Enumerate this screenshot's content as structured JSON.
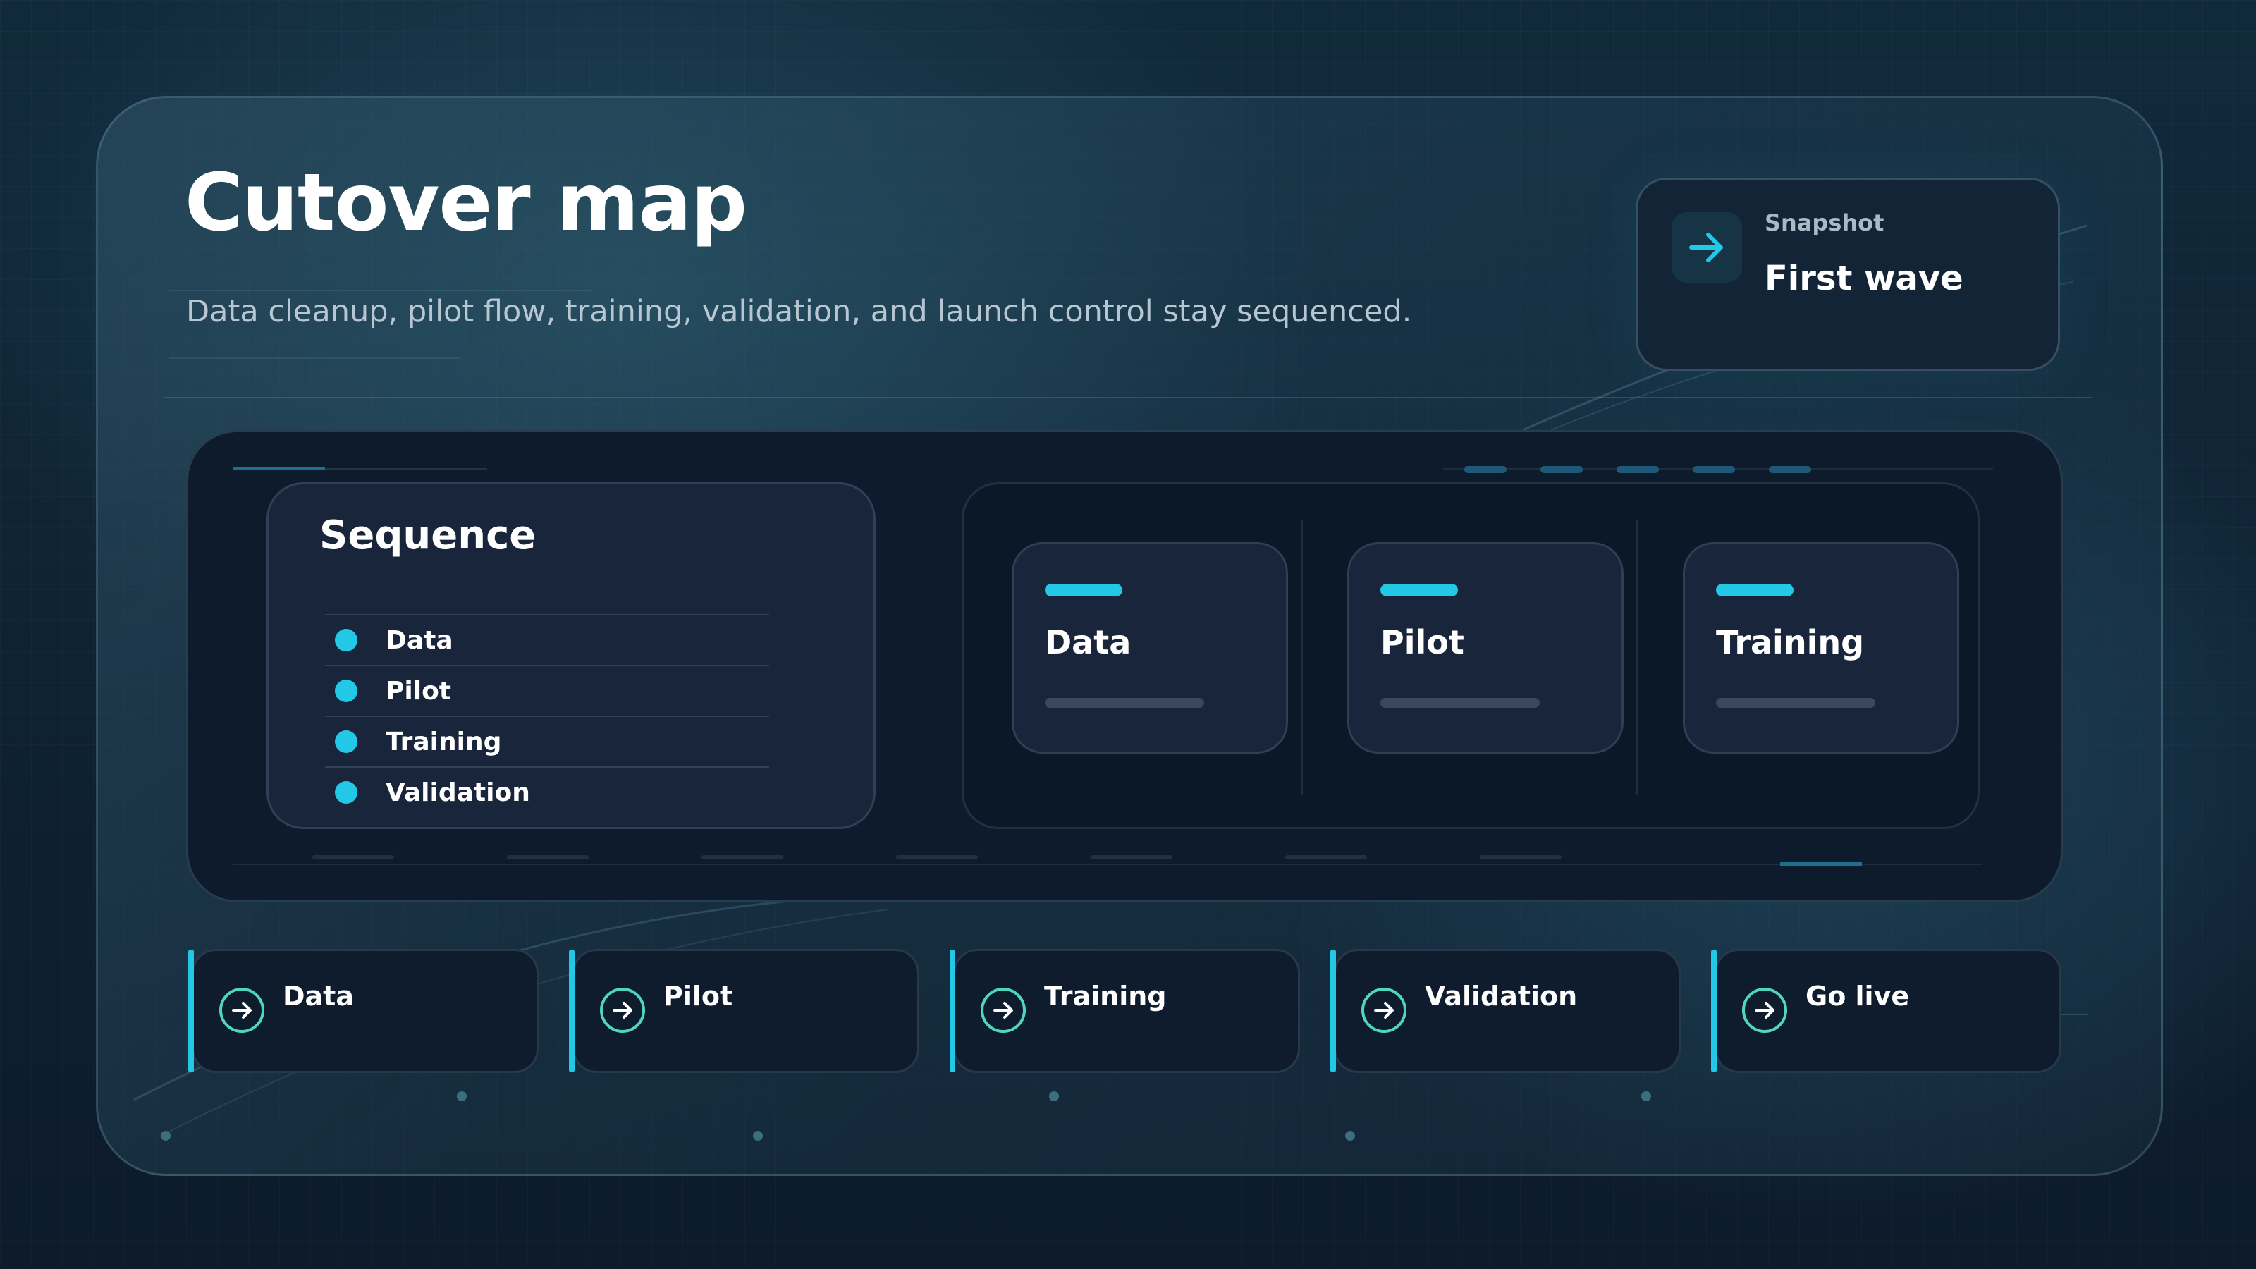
{
  "header": {
    "title": "Cutover map",
    "subtitle": "Data cleanup, pilot flow, training, validation, and launch control stay sequenced."
  },
  "snapshot": {
    "label": "Snapshot",
    "value": "First wave",
    "icon": "arrow-right-icon"
  },
  "sequence": {
    "title": "Sequence",
    "items": [
      "Data",
      "Pilot",
      "Training",
      "Validation"
    ]
  },
  "stages": [
    "Data",
    "Pilot",
    "Training"
  ],
  "steps": [
    "Data",
    "Pilot",
    "Training",
    "Validation",
    "Go live"
  ],
  "colors": {
    "accent": "#22c8e6",
    "step_icon": "#4fd6c2",
    "background": "#0d1b2b",
    "card": "#18253a"
  }
}
